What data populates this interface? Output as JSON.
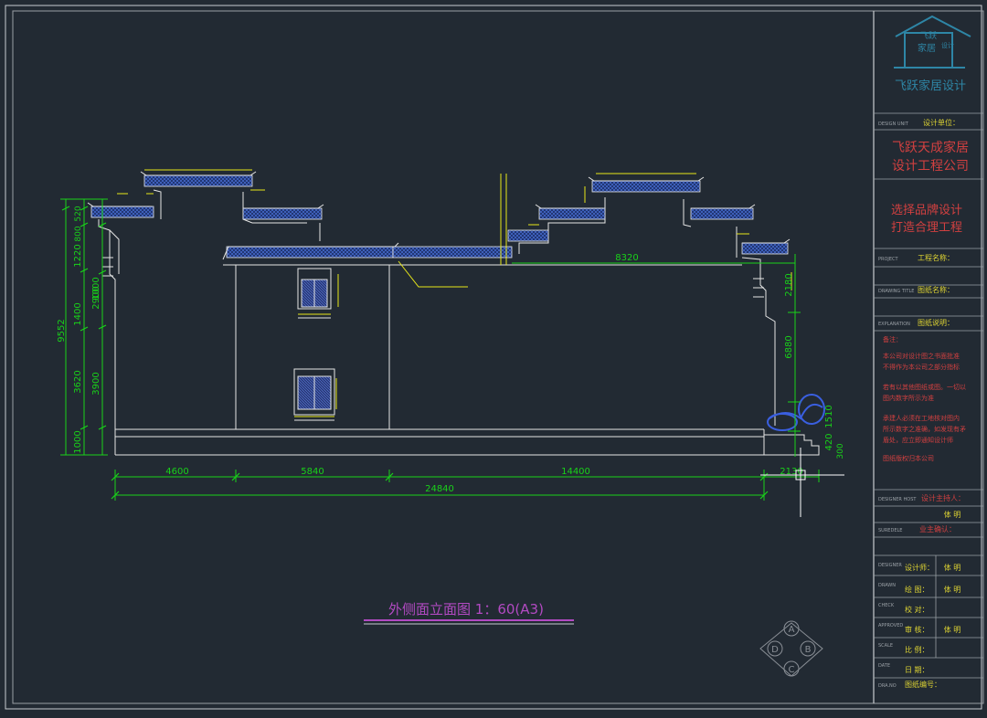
{
  "colors": {
    "background": "#222a33",
    "frame": "#c8ccd0",
    "outline": "#e6e6e6",
    "dimension": "#19d219",
    "annotation": "#e8e81a",
    "roof_tiles": "#3f66c9",
    "title_text": "#b24ac2",
    "logo": "#2e86a6",
    "panel_red": "#d14040",
    "panel_yellow": "#ded433",
    "panel_label": "#9aa0a6"
  },
  "drawing": {
    "title": "外侧面立面图 1：60(A3)",
    "dims_horizontal": {
      "seg1": "4600",
      "seg2": "5840",
      "seg3": "14400",
      "seg4": "2130",
      "total": "24840",
      "upper": "8320"
    },
    "dims_left_outer": {
      "total": "9552",
      "a": "520",
      "b": "800",
      "c": "1220",
      "d": "1400",
      "e": "3620",
      "f": "1000"
    },
    "dims_left_inner": {
      "a": "1000",
      "b": "2900",
      "c": "3900"
    },
    "dims_right": {
      "a": "2180",
      "b": "6880",
      "c": "1510",
      "d": "420",
      "e": "300"
    },
    "north_marks": [
      "A",
      "B",
      "C",
      "D"
    ]
  },
  "title_block": {
    "logo_caption": "飞跃家居设计",
    "logo_mark_1": "飞跃",
    "logo_mark_2": "家居",
    "logo_mark_side": "设计",
    "design_unit_label": "DESIGN UNIT",
    "design_unit_value": "设计单位：",
    "company_line1": "飞跃天成家居",
    "company_line2": "设计工程公司",
    "slogan_line1": "选择品牌设计",
    "slogan_line2": "打造合理工程",
    "project_label": "PROJECT",
    "project_value": "工程名称：",
    "drawing_title_label": "DRAWING TITLE",
    "drawing_title_value": "图纸名称：",
    "explanation_label": "EXPLANATION",
    "explanation_value": "图纸说明：",
    "notes_head": "备注：",
    "note1_line1": "本公司对设计图之书面批准",
    "note1_line2": "不得作为本公司之部分指标",
    "note2_line1": "若有以其他图纸或图。一切以",
    "note2_line2": "图内数字所示为准",
    "note3_line1": "承建人必须在工地核对图内",
    "note3_line2": "所示数字之准确，如发现有矛",
    "note3_line3": "盾处，应立即通知设计师",
    "note4": "图纸版权归本公司",
    "designer_host_label": "DESIGNER HOST",
    "designer_host_value": "设计主持人：",
    "designer_host_name": "体 明",
    "sure_label": "SUREDELE",
    "sure_value": "业主确认：",
    "designer_label": "DESIGNER",
    "designer_value": "设计师：",
    "designer_name": "体 明",
    "drawn_label": "DRAWN",
    "drawn_value": "绘 图：",
    "drawn_name": "体 明",
    "check_label": "CHECK",
    "check_value": "校 对：",
    "approved_label": "APPROVED",
    "approved_value": "审 核：",
    "approved_name": "体 明",
    "scale_label": "SCALE",
    "scale_value": "比 例：",
    "date_label": "DATE",
    "date_value": "日 期：",
    "drawing_no_label": "DRA.NO",
    "drawing_no_value": "图纸编号："
  }
}
